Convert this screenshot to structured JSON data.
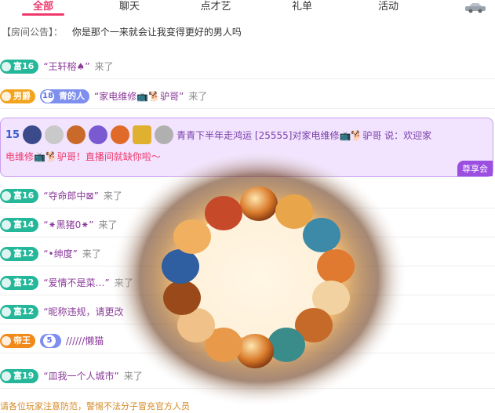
{
  "tabs": [
    "全部",
    "聊天",
    "点才艺",
    "礼单",
    "活动"
  ],
  "notice": {
    "label": "【房间公告】：",
    "text": "你是那个一来就会让我变得更好的男人吗"
  },
  "messages": [
    {
      "badge": "富16",
      "badge_type": "fu",
      "nick": "“王轩榕♠”",
      "action": "来了"
    },
    {
      "badge": "男爵",
      "badge_type": "nan",
      "level": "18",
      "level_label": "青的人",
      "nick": "“家电维修📺🐕驴哥”",
      "action": "来了"
    },
    {
      "badge": "富16",
      "badge_type": "fu",
      "nick": "“夺命郎中⊠”",
      "action": "来了"
    },
    {
      "badge": "富14",
      "badge_type": "fu",
      "nick": "“⁕黑猪0⁕”",
      "action": "来了"
    },
    {
      "badge": "富12",
      "badge_type": "fu",
      "nick": "“•绅度”",
      "action": "来了"
    },
    {
      "badge": "富12",
      "badge_type": "fu",
      "nick": "“爱情不是菜…”",
      "action": "来了"
    },
    {
      "badge": "富12",
      "badge_type": "fu",
      "nick": "“昵称违规，请更改",
      "action": ""
    },
    {
      "badge": "帝王",
      "badge_type": "di",
      "level": "5",
      "nick": "//////懒猫",
      "action": ""
    },
    {
      "badge": "富19",
      "badge_type": "fu",
      "nick": "“皿我一个人城市”",
      "action": "来了"
    }
  ],
  "highlight": {
    "level": "15",
    "text": "青青下半年走鸿运 [25555]对家电维修📺🐕驴哥 说：欢迎家",
    "line2": "电维修📺🐕驴哥！直播间就缺你啦～",
    "vip": "尊享会"
  },
  "warning": "请各位玩家注意防范，警惕不法分子冒充官方人员"
}
